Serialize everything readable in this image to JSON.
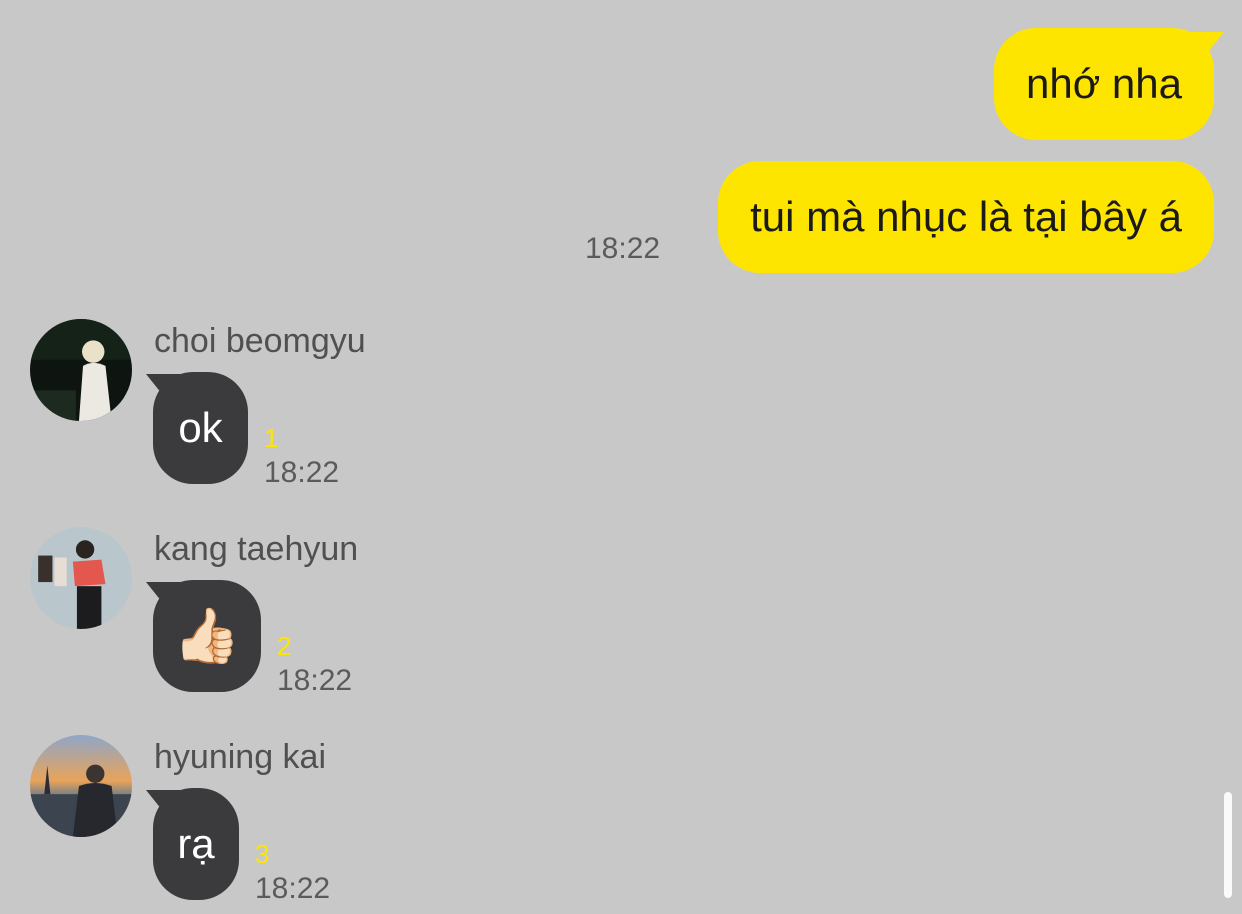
{
  "messages": {
    "outgoing": [
      {
        "text": "nhớ nha"
      },
      {
        "text": "tui mà nhục là tại bây á",
        "time": "18:22"
      }
    ],
    "incoming": [
      {
        "sender": "choi beomgyu",
        "text": "ok",
        "unread": "1",
        "time": "18:22",
        "avatar": "photo-avatar-dark"
      },
      {
        "sender": "kang taehyun",
        "text": "👍🏻",
        "unread": "2",
        "time": "18:22",
        "avatar": "photo-avatar-red-shirt"
      },
      {
        "sender": "hyuning kai",
        "text": "rạ",
        "unread": "3",
        "time": "18:22",
        "avatar": "photo-avatar-sunset"
      }
    ]
  },
  "colors": {
    "background": "#c8c8c8",
    "outgoing_bubble": "#fee500",
    "incoming_bubble": "#3b3b3d",
    "unread_count": "#fee500"
  }
}
